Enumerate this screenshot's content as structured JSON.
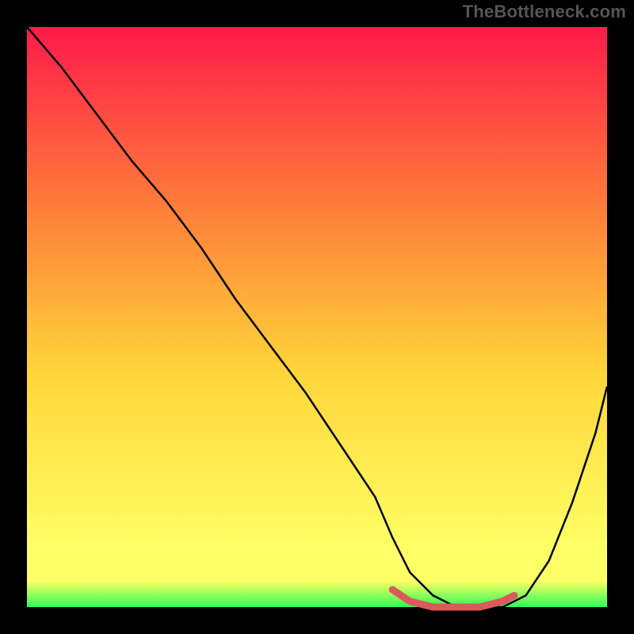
{
  "watermark": "TheBottleneck.com",
  "chart_data": {
    "type": "line",
    "title": "",
    "xlabel": "",
    "ylabel": "",
    "x_range": [
      0,
      100
    ],
    "y_range": [
      0,
      100
    ],
    "grid": false,
    "legend": false,
    "background_gradient": [
      "#ff1a4b",
      "#ff7a3a",
      "#ffd63a",
      "#ffff66",
      "#2bff55"
    ],
    "curve": {
      "x": [
        0,
        6,
        12,
        18,
        24,
        30,
        36,
        42,
        48,
        54,
        60,
        63,
        66,
        70,
        74,
        78,
        82,
        86,
        90,
        94,
        98,
        100
      ],
      "y": [
        100,
        93,
        85,
        77,
        70,
        62,
        53,
        45,
        37,
        28,
        19,
        12,
        6,
        2,
        0,
        0,
        0,
        2,
        8,
        18,
        30,
        38
      ]
    },
    "optimum_segment": {
      "x": [
        63,
        66,
        70,
        74,
        78,
        82,
        84
      ],
      "y": [
        3,
        1,
        0,
        0,
        0,
        1,
        2
      ],
      "color": "#d85a5a",
      "width": 9
    }
  }
}
